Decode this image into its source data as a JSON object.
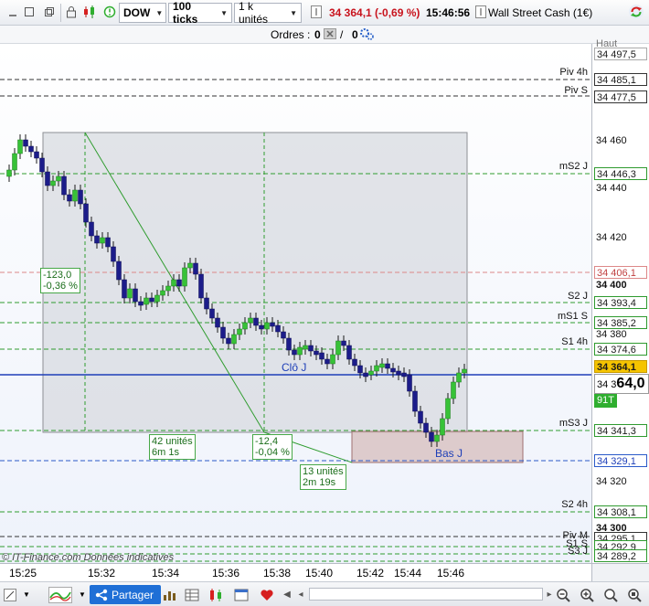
{
  "toolbar": {
    "symbol": "DOW",
    "ticks": "100 ticks",
    "units": "1 k unités",
    "price_change": "34 364,1 (-0,69 %)",
    "time": "15:46:56",
    "instrument": "Wall Street Cash (1€)"
  },
  "orders": {
    "label": "Ordres :",
    "count1": "0",
    "count2": "0"
  },
  "levels": [
    {
      "name": "Piv 4h",
      "value": "34 485,1"
    },
    {
      "name": "Piv S",
      "value": "34 477,5"
    },
    {
      "name": "mS2 J",
      "value": "34 446,3"
    },
    {
      "name": "",
      "value": "34 406,1"
    },
    {
      "name": "S2 J",
      "value": "34 393,4"
    },
    {
      "name": "mS1 S",
      "value": "34 385,2"
    },
    {
      "name": "S1 4h",
      "value": "34 374,6"
    },
    {
      "name": "mS3 J",
      "value": "34 341,3"
    },
    {
      "name": "",
      "value": "34 329,1"
    },
    {
      "name": "S2 4h",
      "value": "34 308,1"
    },
    {
      "name": "Piv M",
      "value": "34 295,1"
    },
    {
      "name": "S1 S",
      "value": "34 292,9"
    },
    {
      "name": "S3 J",
      "value": "34 289,2"
    }
  ],
  "axis_ticks": [
    "34 497,5",
    "34 460",
    "34 440",
    "34 420",
    "34 380",
    "34 320",
    "34 300"
  ],
  "current": {
    "price": "34 364,1",
    "big_prefix": "34 3",
    "big_suffix": "64,0",
    "ticks": "91T",
    "level_400": "34 400"
  },
  "annotations": {
    "box_left": "-123,0\n-0,36 %",
    "units1": "42 unités\n6m 1s",
    "diff": "-12,4\n-0,04 %",
    "units2": "13 unités\n2m 19s",
    "close_j": "Clô J",
    "bas_j": "Bas J",
    "top_partial": "Haut"
  },
  "x_labels": [
    "15:25",
    "15:32",
    "15:34",
    "15:36",
    "15:38",
    "15:40",
    "15:42",
    "15:44",
    "15:46"
  ],
  "watermark": "© IT-Finance.com  Données indicatives",
  "bottom": {
    "share": "Partager"
  },
  "chart_data": {
    "type": "candlestick",
    "x": [
      "15:25",
      "15:32",
      "15:34",
      "15:36",
      "15:38",
      "15:40",
      "15:42",
      "15:44",
      "15:46"
    ],
    "price_range": [
      34289,
      34500
    ]
  }
}
